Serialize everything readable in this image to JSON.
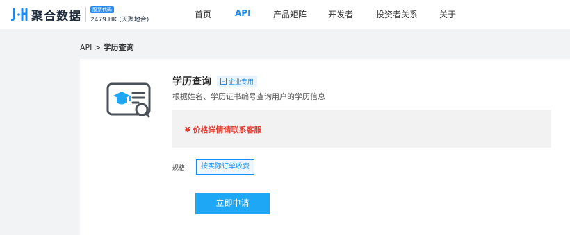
{
  "header": {
    "brand_name": "聚合数据",
    "stock_badge": "股票代码",
    "stock_code": "2479.HK (天聚地合)",
    "nav": [
      {
        "label": "首页",
        "active": false
      },
      {
        "label": "API",
        "active": true
      },
      {
        "label": "产品矩阵",
        "active": false
      },
      {
        "label": "开发者",
        "active": false
      },
      {
        "label": "投资者关系",
        "active": false
      },
      {
        "label": "关于",
        "active": false
      }
    ]
  },
  "breadcrumb": {
    "root": "API",
    "separator": ">",
    "current": "学历查询"
  },
  "product": {
    "title": "学历查询",
    "tag": "企业专用",
    "description": "根据姓名、学历证书编号查询用户的学历信息",
    "price_text": "¥ 价格详情请联系客服",
    "spec_label": "规格",
    "spec_option": "按实际订单收费",
    "apply_label": "立即申请",
    "icon": "education-certificate-icon"
  },
  "colors": {
    "accent": "#1a8cf0",
    "price": "#e83a2e",
    "button": "#1ea7f5"
  }
}
